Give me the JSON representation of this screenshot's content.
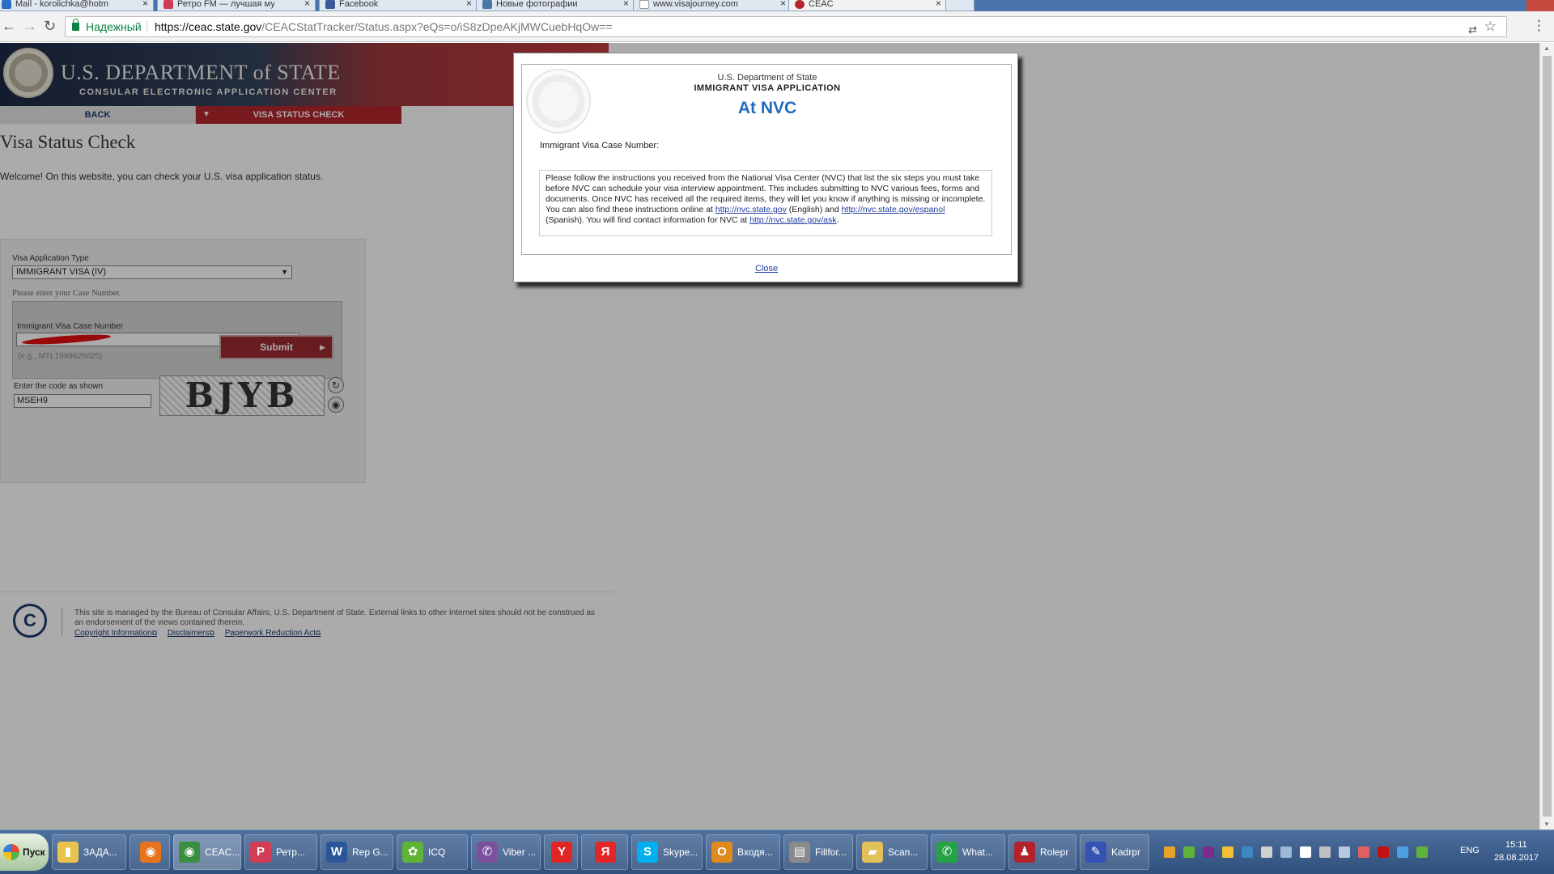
{
  "browser": {
    "tabs": [
      {
        "title": "Mail - korolichka@hotm",
        "favicon_color": "#2a6dc5"
      },
      {
        "title": "Ретро FM — лучшая му",
        "favicon_color": "#d23c54"
      },
      {
        "title": "Facebook",
        "favicon_color": "#3b5998"
      },
      {
        "title": "Новые фотографии",
        "favicon_color": "#4a76a8"
      },
      {
        "title": "www.visajourney.com",
        "favicon_color": "#ffffff"
      },
      {
        "title": "CEAC",
        "favicon_color": "#b3262d"
      }
    ],
    "tab_close": "×",
    "nav": {
      "back": "←",
      "forward": "→",
      "reload": "↻"
    },
    "secure_label": "Надежный",
    "url_host": "https://ceac.state.gov",
    "url_path": "/CEACStatTracker/Status.aspx?eQs=o/iS8zDpeAKjMWCuebHqOw==",
    "translate": "⇄",
    "star": "☆",
    "menu": "⋮"
  },
  "site": {
    "dept_title": "U.S. DEPARTMENT of STATE",
    "dept_subtitle": "CONSULAR ELECTRONIC APPLICATION CENTER",
    "nav_back": "BACK",
    "nav_visa_status": "VISA STATUS CHECK",
    "nav_arrow": "▼",
    "page_title": "Visa Status Check",
    "welcome": "Welcome! On this website, you can check your U.S. visa application status."
  },
  "form": {
    "visa_type_label": "Visa Application Type",
    "visa_type_value": "IMMIGRANT VISA (IV)",
    "select_arrow": "▼",
    "case_hint": "Please enter your Case Number.",
    "case_label": "Immigrant Visa Case Number",
    "case_example": "(e.g., MTL1999626025)",
    "captcha_label": "Enter the code as shown",
    "captcha_value": "MSEH9",
    "captcha_image_text": "BJYB",
    "refresh": "↻",
    "audio": "◉",
    "submit": "Submit",
    "submit_arrow": "▶"
  },
  "footer": {
    "logo": "C",
    "text": "This site is managed by the Bureau of Consular Affairs, U.S. Department of State. External links to other Internet sites should not be construed as an endorsement of the views contained therein.",
    "links": [
      "Copyright Information",
      "Disclaimers",
      "Paperwork Reduction Act"
    ],
    "ext": "⧉"
  },
  "modal": {
    "dept": "U.S. Department of State",
    "app_title": "IMMIGRANT VISA APPLICATION",
    "status": "At NVC",
    "case_label": "Immigrant Visa Case Number:",
    "instructions_1": "Please follow the instructions you received from the National Visa Center (NVC) that list the six steps you must take before NVC can schedule your visa interview appointment. This includes submitting to NVC various fees, forms and documents. Once NVC has received all the required items, they will let you know if anything is missing or incomplete. You can also find these instructions online at ",
    "link_english": "http://nvc.state.gov",
    "instructions_2": " (English) and ",
    "link_spanish": "http://nvc.state.gov/espanol",
    "instructions_3": " (Spanish). You will find contact information for NVC at ",
    "link_ask": "http://nvc.state.gov/ask",
    "instructions_4": ".",
    "close": "Close"
  },
  "taskbar": {
    "start": "Пуск",
    "buttons": [
      {
        "label": "ЗАДА...",
        "icon": "▮",
        "color": "#e8c24a"
      },
      {
        "label": "",
        "icon": "◉",
        "color": "#e8731e"
      },
      {
        "label": "CEAC...",
        "icon": "◉",
        "color": "#3b8e3f"
      },
      {
        "label": "Ретр...",
        "icon": "Р",
        "color": "#d23c54"
      },
      {
        "label": "Rep G...",
        "icon": "W",
        "color": "#2b579a"
      },
      {
        "label": "ICQ",
        "icon": "✿",
        "color": "#5fb336"
      },
      {
        "label": "Viber ...",
        "icon": "✆",
        "color": "#7b519d"
      },
      {
        "label": "",
        "icon": "Y",
        "color": "#e22626"
      },
      {
        "label": "",
        "icon": "Я",
        "color": "#e22626"
      },
      {
        "label": "Skype...",
        "icon": "S",
        "color": "#00aff0"
      },
      {
        "label": "Входя...",
        "icon": "O",
        "color": "#e08a1e"
      },
      {
        "label": "Fillfor...",
        "icon": "▤",
        "color": "#8a8a8a"
      },
      {
        "label": "Scan...",
        "icon": "▰",
        "color": "#e3c15a"
      },
      {
        "label": "What...",
        "icon": "✆",
        "color": "#25a244"
      },
      {
        "label": "Rolepr",
        "icon": "♟",
        "color": "#b2222a"
      },
      {
        "label": "Kadrpr",
        "icon": "✎",
        "color": "#3553b4"
      }
    ],
    "tray_colors": [
      "#e8a32b",
      "#5fb336",
      "#7b2c8c",
      "#f1c232",
      "#3b88c4",
      "#d0d0d0",
      "#a0b8d8",
      "#ffffff",
      "#c0c0c0",
      "#b6c8e0",
      "#e06060",
      "#c41010",
      "#4fa0e0",
      "#5fb336"
    ],
    "lang": "ENG",
    "time": "15:11",
    "date": "28.08.2017"
  }
}
